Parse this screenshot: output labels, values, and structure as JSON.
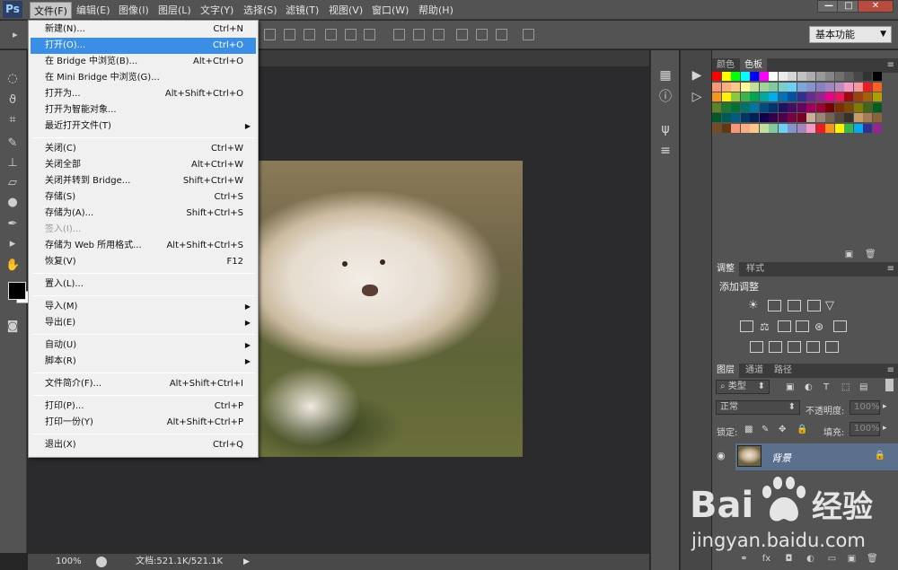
{
  "app": {
    "logo": "Ps"
  },
  "menubar": {
    "items": [
      "文件(F)",
      "编辑(E)",
      "图像(I)",
      "图层(L)",
      "文字(Y)",
      "选择(S)",
      "滤镜(T)",
      "视图(V)",
      "窗口(W)",
      "帮助(H)"
    ],
    "active_index": 0,
    "window_buttons": [
      "—",
      "□",
      "✕"
    ]
  },
  "options_bar": {
    "workspace": "基本功能"
  },
  "file_menu": {
    "items": [
      {
        "label": "新建(N)...",
        "shortcut": "Ctrl+N"
      },
      {
        "label": "打开(O)...",
        "shortcut": "Ctrl+O",
        "highlighted": true
      },
      {
        "label": "在 Bridge 中浏览(B)...",
        "shortcut": "Alt+Ctrl+O"
      },
      {
        "label": "在 Mini Bridge 中浏览(G)...",
        "shortcut": ""
      },
      {
        "label": "打开为...",
        "shortcut": "Alt+Shift+Ctrl+O"
      },
      {
        "label": "打开为智能对象...",
        "shortcut": ""
      },
      {
        "label": "最近打开文件(T)",
        "shortcut": "",
        "submenu": true
      },
      {
        "separator": true
      },
      {
        "label": "关闭(C)",
        "shortcut": "Ctrl+W"
      },
      {
        "label": "关闭全部",
        "shortcut": "Alt+Ctrl+W"
      },
      {
        "label": "关闭并转到 Bridge...",
        "shortcut": "Shift+Ctrl+W"
      },
      {
        "label": "存储(S)",
        "shortcut": "Ctrl+S"
      },
      {
        "label": "存储为(A)...",
        "shortcut": "Shift+Ctrl+S"
      },
      {
        "label": "签入(I)...",
        "shortcut": "",
        "disabled": true
      },
      {
        "label": "存储为 Web 所用格式...",
        "shortcut": "Alt+Shift+Ctrl+S"
      },
      {
        "label": "恢复(V)",
        "shortcut": "F12"
      },
      {
        "separator": true
      },
      {
        "label": "置入(L)...",
        "shortcut": ""
      },
      {
        "separator": true
      },
      {
        "label": "导入(M)",
        "shortcut": "",
        "submenu": true
      },
      {
        "label": "导出(E)",
        "shortcut": "",
        "submenu": true
      },
      {
        "separator": true
      },
      {
        "label": "自动(U)",
        "shortcut": "",
        "submenu": true
      },
      {
        "label": "脚本(R)",
        "shortcut": "",
        "submenu": true
      },
      {
        "separator": true
      },
      {
        "label": "文件简介(F)...",
        "shortcut": "Alt+Shift+Ctrl+I"
      },
      {
        "separator": true
      },
      {
        "label": "打印(P)...",
        "shortcut": "Ctrl+P"
      },
      {
        "label": "打印一份(Y)",
        "shortcut": "Alt+Shift+Ctrl+P"
      },
      {
        "separator": true
      },
      {
        "label": "退出(X)",
        "shortcut": "Ctrl+Q"
      }
    ]
  },
  "status": {
    "zoom": "100%",
    "doc": "文档:521.1K/521.1K"
  },
  "swatches_panel": {
    "tabs": [
      "颜色",
      "色板"
    ],
    "active_tab": 1,
    "rows": [
      [
        "#ff0000",
        "#ffff00",
        "#00ff00",
        "#00ffff",
        "#0000ff",
        "#ff00ff",
        "#ffffff",
        "#ebebeb",
        "#d6d6d6",
        "#c2c2c2",
        "#adadad",
        "#999999",
        "#858585",
        "#707070",
        "#5c5c5c",
        "#474747",
        "#333333",
        "#000000"
      ],
      [
        "#f7977a",
        "#f9ad81",
        "#fdc68a",
        "#fff79a",
        "#c4df9b",
        "#a3d39c",
        "#82ca9d",
        "#7bcdc8",
        "#6ecff6",
        "#7ea7d8",
        "#8493ca",
        "#8882be",
        "#a187be",
        "#bc8dbf",
        "#f49ac2",
        "#f6989d",
        "#ed1c24",
        "#f26522"
      ],
      [
        "#f7941d",
        "#fff200",
        "#8dc73f",
        "#39b54a",
        "#00a651",
        "#00a99d",
        "#00aeef",
        "#0072bc",
        "#0054a6",
        "#2e3192",
        "#662d91",
        "#92278f",
        "#ec008c",
        "#ed145b",
        "#9e0b0f",
        "#a0410d",
        "#a3620a",
        "#aba000"
      ],
      [
        "#598527",
        "#197b30",
        "#007236",
        "#00746b",
        "#0076a3",
        "#004b80",
        "#003471",
        "#1b1464",
        "#440e62",
        "#630460",
        "#9e005d",
        "#9e0039",
        "#790000",
        "#7b2e00",
        "#7d4900",
        "#827b00",
        "#406618",
        "#005e20"
      ],
      [
        "#005826",
        "#005952",
        "#005b7f",
        "#003663",
        "#002157",
        "#0d004c",
        "#32004b",
        "#4b0049",
        "#7b0046",
        "#7a0026",
        "#c7b299",
        "#998675",
        "#736357",
        "#534741",
        "#37302d",
        "#c69c6d",
        "#a67c52",
        "#8c6239"
      ],
      [
        "#754c24",
        "#603913",
        "#f7977a",
        "#f9ad81",
        "#fdc68a",
        "#c4df9b",
        "#82ca9d",
        "#6ecff6",
        "#8493ca",
        "#a187be",
        "#f49ac2",
        "#ed1c24",
        "#f7941d",
        "#fff200",
        "#39b54a",
        "#00aeef",
        "#2e3192",
        "#92278f"
      ]
    ]
  },
  "adjustments_panel": {
    "tabs": [
      "调整",
      "样式"
    ],
    "active_tab": 0,
    "title": "添加调整"
  },
  "layers_panel": {
    "tabs": [
      "图层",
      "通道",
      "路径"
    ],
    "active_tab": 0,
    "filter": "类型",
    "blend_mode": "正常",
    "opacity_label": "不透明度:",
    "opacity": "100%",
    "lock_label": "锁定:",
    "fill_label": "填充:",
    "fill": "100%",
    "layers": [
      {
        "name": "背景",
        "locked": true,
        "visible": true
      }
    ]
  },
  "watermark": {
    "brand": "Bai度经验",
    "url": "jingyan.baidu.com"
  }
}
